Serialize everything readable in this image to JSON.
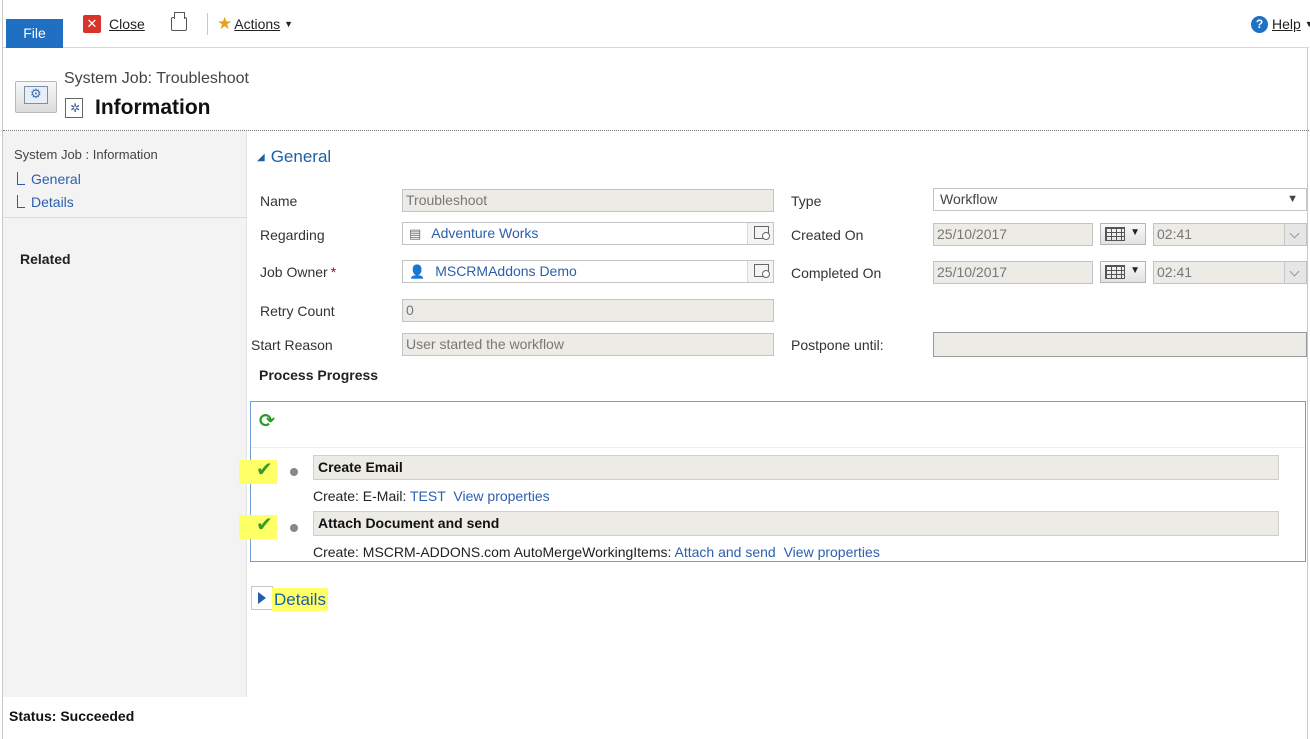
{
  "toolbar": {
    "file": "File",
    "close": "Close",
    "actions": "Actions",
    "help": "Help"
  },
  "header": {
    "subtitle": "System Job: Troubleshoot",
    "title": "Information"
  },
  "nav": {
    "heading": "System Job : Information",
    "items": [
      {
        "label": "General"
      },
      {
        "label": "Details"
      }
    ],
    "related": "Related"
  },
  "section": {
    "title": "General"
  },
  "form": {
    "name_label": "Name",
    "name_value": "Troubleshoot",
    "regarding_label": "Regarding",
    "regarding_value": "Adventure Works",
    "owner_label": "Job Owner",
    "owner_required": "*",
    "owner_value": "MSCRMAddons Demo",
    "retry_label": "Retry Count",
    "retry_value": "0",
    "start_reason_label": "Start Reason",
    "start_reason_value": "User started the workflow",
    "type_label": "Type",
    "type_value": "Workflow",
    "created_label": "Created On",
    "created_date": "25/10/2017",
    "created_time": "02:41",
    "completed_label": "Completed On",
    "completed_date": "25/10/2017",
    "completed_time": "02:41",
    "postpone_label": "Postpone until:",
    "postpone_value": ""
  },
  "process": {
    "title": "Process Progress",
    "steps": [
      {
        "name": "Create Email",
        "desc_prefix": "Create:  E-Mail:",
        "desc_link": "TEST",
        "view": "View properties"
      },
      {
        "name": "Attach Document and send",
        "desc_prefix": "Create:  MSCRM-ADDONS.com AutoMergeWorkingItems:",
        "desc_link": "Attach and send",
        "view": "View properties"
      }
    ]
  },
  "details": {
    "label": "Details"
  },
  "status": {
    "text": "Status: Succeeded"
  },
  "colors": {
    "accent": "#1f6fc2",
    "link": "#2b5fae",
    "highlight": "#ffff66",
    "success": "#3a9a2a"
  }
}
